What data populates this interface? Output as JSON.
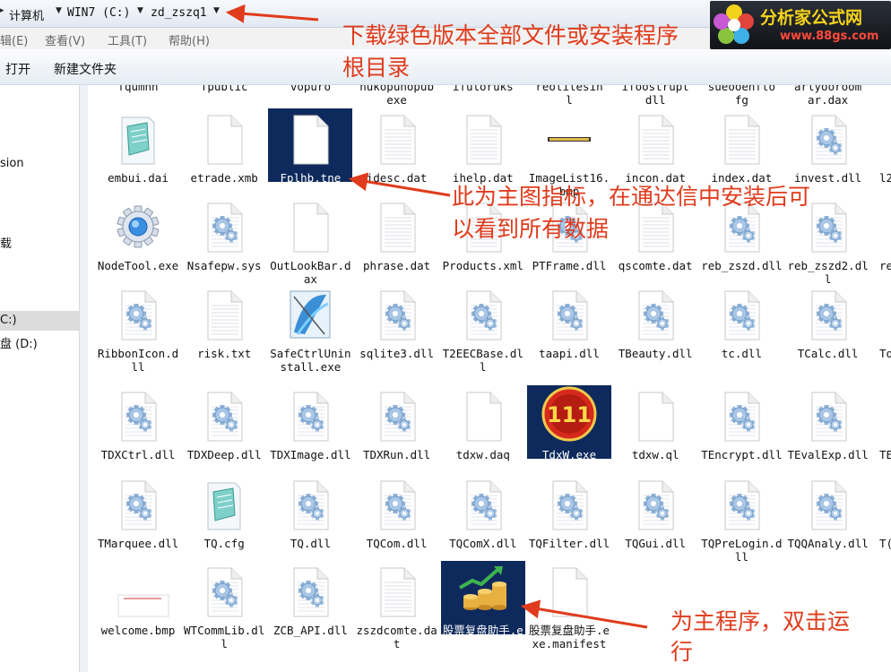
{
  "breadcrumb": {
    "items": [
      "计算机",
      "WIN7 (C:)",
      "zd_zszq1"
    ]
  },
  "menu": {
    "items": [
      "辑(E)",
      "查看(V)",
      "工具(T)",
      "帮助(H)"
    ]
  },
  "toolbar": {
    "open_label": "打开",
    "new_folder_label": "新建文件夹"
  },
  "nav": {
    "items": [
      {
        "label": "sion"
      },
      {
        "label": "载"
      },
      {
        "label": "C:)"
      },
      {
        "label": "盘 (D:)"
      }
    ]
  },
  "logo": {
    "title": "分析家公式网",
    "url": "www.88gs.com"
  },
  "top_partial": [
    "fqumnn",
    "fpublic",
    "vopuro",
    "hukopunopub\nexe",
    "ifuloruks",
    "reolilesin\nl",
    "ifoostrupt\ndll",
    "sueooenfto\nfg",
    "arlyooroom\nar.dax"
  ],
  "files": [
    {
      "name": "embui.dai",
      "icon": "notepad-icon"
    },
    {
      "name": "etrade.xmb",
      "icon": "blank-file-icon"
    },
    {
      "name": "Fplhb.tne",
      "icon": "blank-file-icon",
      "selected": true
    },
    {
      "name": "idesc.dat",
      "icon": "lined-file-icon"
    },
    {
      "name": "ihelp.dat",
      "icon": "lined-file-icon"
    },
    {
      "name": "ImageList16.bmp",
      "icon": "bitmap-strip-icon"
    },
    {
      "name": "incon.dat",
      "icon": "lined-file-icon"
    },
    {
      "name": "index.dat",
      "icon": "lined-file-icon"
    },
    {
      "name": "invest.dll",
      "icon": "dll-gear-icon"
    },
    {
      "name": "NodeTool.exe",
      "icon": "gear-app-icon"
    },
    {
      "name": "Nsafepw.sys",
      "icon": "dll-gear-icon"
    },
    {
      "name": "OutLookBar.dax",
      "icon": "blank-file-icon"
    },
    {
      "name": "phrase.dat",
      "icon": "lined-file-icon"
    },
    {
      "name": "Products.xml",
      "icon": "lined-file-icon"
    },
    {
      "name": "PTFrame.dll",
      "icon": "dll-gear-icon"
    },
    {
      "name": "qscomte.dat",
      "icon": "lined-file-icon"
    },
    {
      "name": "reb_zszd.dll",
      "icon": "dll-gear-icon"
    },
    {
      "name": "reb_zszd2.dll",
      "icon": "dll-gear-icon"
    },
    {
      "name": "RibbonIcon.dll",
      "icon": "dll-gear-icon"
    },
    {
      "name": "risk.txt",
      "icon": "lined-file-icon"
    },
    {
      "name": "SafeCtrlUninstall.exe",
      "icon": "installer-icon"
    },
    {
      "name": "sqlite3.dll",
      "icon": "dll-gear-icon"
    },
    {
      "name": "T2EECBase.dll",
      "icon": "dll-gear-icon"
    },
    {
      "name": "taapi.dll",
      "icon": "dll-gear-icon"
    },
    {
      "name": "TBeauty.dll",
      "icon": "dll-gear-icon"
    },
    {
      "name": "tc.dll",
      "icon": "dll-gear-icon"
    },
    {
      "name": "TCalc.dll",
      "icon": "dll-gear-icon"
    },
    {
      "name": "TDXCtrl.dll",
      "icon": "dll-gear-icon"
    },
    {
      "name": "TDXDeep.dll",
      "icon": "dll-gear-icon"
    },
    {
      "name": "TDXImage.dll",
      "icon": "dll-gear-icon"
    },
    {
      "name": "TDXRun.dll",
      "icon": "dll-gear-icon"
    },
    {
      "name": "tdxw.daq",
      "icon": "blank-file-icon"
    },
    {
      "name": "TdxW.exe",
      "icon": "tdx-111-icon",
      "selected": true
    },
    {
      "name": "tdxw.ql",
      "icon": "blank-file-icon"
    },
    {
      "name": "TEncrypt.dll",
      "icon": "dll-gear-icon"
    },
    {
      "name": "TEvalExp.dll",
      "icon": "dll-gear-icon"
    },
    {
      "name": "TMarquee.dll",
      "icon": "dll-gear-icon"
    },
    {
      "name": "TQ.cfg",
      "icon": "notepad-icon"
    },
    {
      "name": "TQ.dll",
      "icon": "dll-gear-icon"
    },
    {
      "name": "TQCom.dll",
      "icon": "dll-gear-icon"
    },
    {
      "name": "TQComX.dll",
      "icon": "dll-gear-icon"
    },
    {
      "name": "TQFilter.dll",
      "icon": "dll-gear-icon"
    },
    {
      "name": "TQGui.dll",
      "icon": "dll-gear-icon"
    },
    {
      "name": "TQPreLogin.dll",
      "icon": "dll-gear-icon"
    },
    {
      "name": "TQQAnaly.dll",
      "icon": "dll-gear-icon"
    },
    {
      "name": "welcome.bmp",
      "icon": "bitmap-banner-icon"
    },
    {
      "name": "WTCommLib.dll",
      "icon": "dll-gear-icon"
    },
    {
      "name": "ZCB_API.dll",
      "icon": "dll-gear-icon"
    },
    {
      "name": "zszdcomte.dat",
      "icon": "lined-file-icon"
    },
    {
      "name": "股票复盘助手.exe",
      "icon": "coins-chart-icon",
      "selected": true
    },
    {
      "name": "股票复盘助手.exe.manifest",
      "icon": "blank-file-icon"
    }
  ],
  "right_edge_partial": [
    "l2",
    "re",
    "To",
    "TE",
    "T("
  ],
  "annotations": {
    "top_line1": "下载绿色版本全部文件或安装程序",
    "top_line2": "根目录",
    "middle_line1": "此为主图指标，在通达信中安装后可",
    "middle_line2": "以看到所有数据",
    "bottom_line1": "为主程序，双击运",
    "bottom_line2": "行"
  },
  "colors": {
    "annotation_red": "#e03b1c",
    "selection_navy": "#0e2a5c"
  }
}
